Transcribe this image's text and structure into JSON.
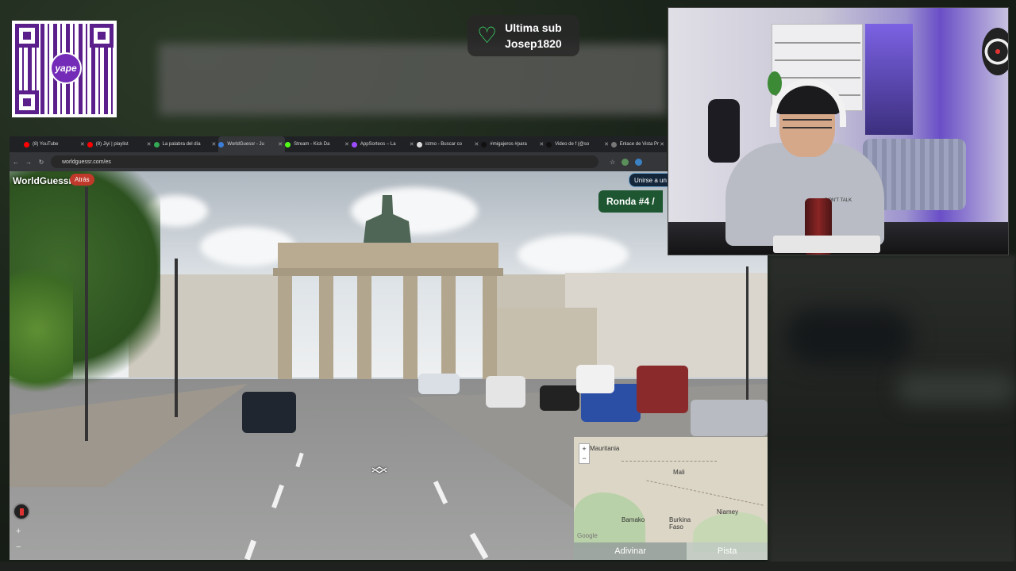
{
  "sub_alert": {
    "line1": "Ultima sub",
    "line2": "Josep1820"
  },
  "qr": {
    "logo_text": "yape"
  },
  "browser": {
    "tabs": [
      {
        "label": "(8) YouTube",
        "fav": "#ff0000"
      },
      {
        "label": "(8) Jiyi | playlist",
        "fav": "#ff0000"
      },
      {
        "label": "La palabra del día",
        "fav": "#34a853"
      },
      {
        "label": "WorldGuessr - Ju",
        "fav": "#3b7dd8",
        "active": true
      },
      {
        "label": "Stream - Kick Da",
        "fav": "#53fc18"
      },
      {
        "label": "AppSorteos – La",
        "fav": "#9b4dff"
      },
      {
        "label": "istmo - Buscar co",
        "fav": "#dddddd"
      },
      {
        "label": "#migajeros #para",
        "fav": "#111111"
      },
      {
        "label": "Video de f (@so",
        "fav": "#111111"
      },
      {
        "label": "Enlace de Vista Pr",
        "fav": "#777777"
      }
    ],
    "url": "worldguessr.com/es"
  },
  "game": {
    "brand": "WorldGuessr",
    "back_label": "Atrás",
    "join_label": "Unirse a un",
    "round_label": "Ronda #4 /",
    "zoom_in": "+",
    "zoom_out": "−"
  },
  "minimap": {
    "labels": [
      "Mauritania",
      "Mali",
      "Burkina Faso",
      "Niamey",
      "Bamako"
    ],
    "zoom_in": "+",
    "zoom_out": "−",
    "attribution": "Google",
    "guess_label": "Adivinar",
    "hint_label": "Pista"
  },
  "webcam": {
    "shirt_text": "DON'T TALK"
  }
}
